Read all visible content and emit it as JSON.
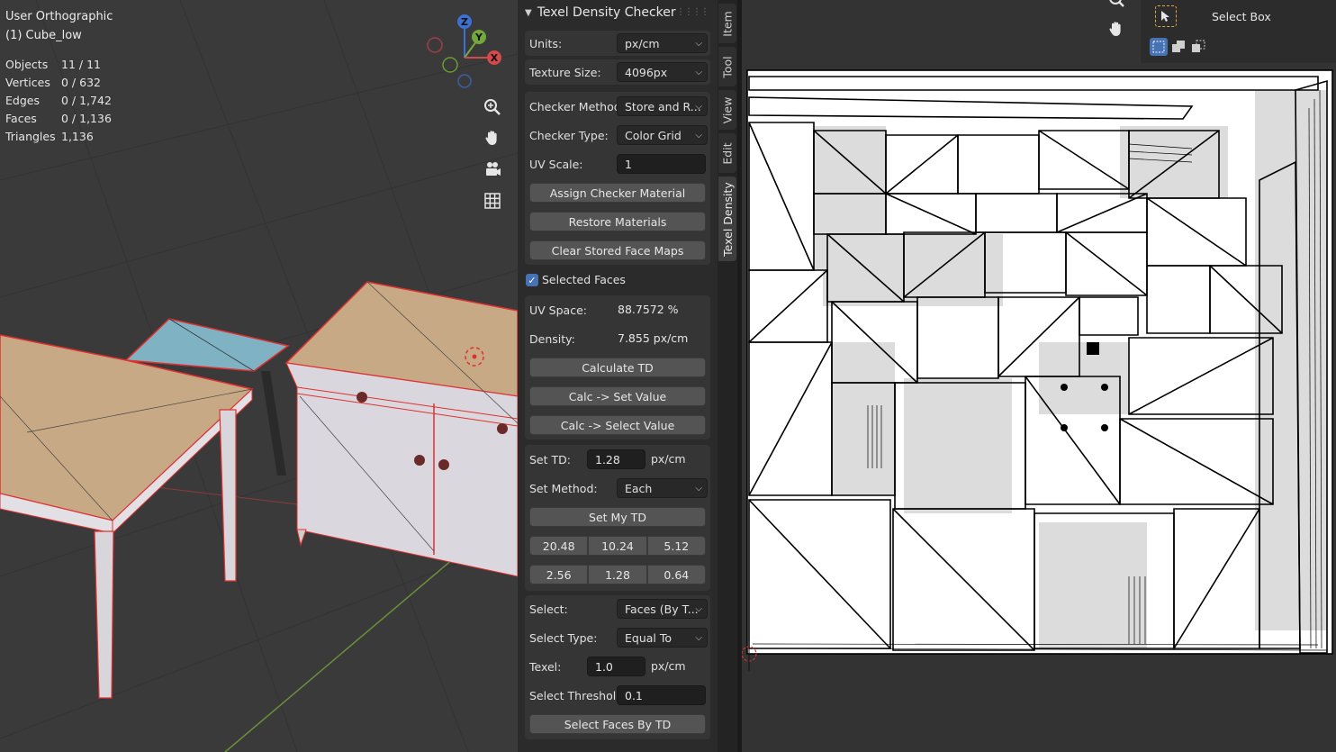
{
  "viewport": {
    "view_name": "User Orthographic",
    "object_name": "(1) Cube_low",
    "stats": [
      {
        "label": "Objects",
        "value": "11 / 11"
      },
      {
        "label": "Vertices",
        "value": "0 / 632"
      },
      {
        "label": "Edges",
        "value": "0 / 1,742"
      },
      {
        "label": "Faces",
        "value": "0 / 1,136"
      },
      {
        "label": "Triangles",
        "value": "1,136"
      }
    ],
    "gizmo_axes": [
      "Z",
      "Y",
      "X"
    ],
    "nav_icons": [
      "zoom-icon",
      "hand-icon",
      "camera-icon",
      "grid-icon"
    ]
  },
  "panel": {
    "title": "Texel Density Checker",
    "units_label": "Units:",
    "units_value": "px/cm",
    "texture_size_label": "Texture Size:",
    "texture_size_value": "4096px",
    "checker_method_label": "Checker Method:",
    "checker_method_value": "Store and R...",
    "checker_type_label": "Checker Type:",
    "checker_type_value": "Color Grid",
    "uv_scale_label": "UV Scale:",
    "uv_scale_value": "1",
    "assign_checker": "Assign Checker Material",
    "restore_materials": "Restore Materials",
    "clear_face_maps": "Clear Stored Face Maps",
    "selected_faces_label": "Selected Faces",
    "selected_faces_checked": true,
    "uv_space_label": "UV Space:",
    "uv_space_value": "88.7572 %",
    "density_label": "Density:",
    "density_value": "7.855 px/cm",
    "calculate_td": "Calculate TD",
    "calc_set_value": "Calc -> Set Value",
    "calc_select_value": "Calc -> Select Value",
    "set_td_label": "Set TD:",
    "set_td_value": "1.28",
    "set_td_unit": "px/cm",
    "set_method_label": "Set Method:",
    "set_method_value": "Each",
    "set_my_td": "Set My TD",
    "presets_row1": [
      "20.48",
      "10.24",
      "5.12"
    ],
    "presets_row2": [
      "2.56",
      "1.28",
      "0.64"
    ],
    "select_label": "Select:",
    "select_value": "Faces (By T...",
    "select_type_label": "Select Type:",
    "select_type_value": "Equal To",
    "texel_label": "Texel:",
    "texel_value": "1.0",
    "texel_unit": "px/cm",
    "select_threshold_label": "Select Threshold:",
    "select_threshold_value": "0.1",
    "select_faces_by_td": "Select Faces By TD"
  },
  "tabs": [
    "Item",
    "Tool",
    "View",
    "Edit",
    "Texel Density"
  ],
  "active_tab": "Texel Density",
  "uv_editor": {
    "tool_label": "Select Box"
  },
  "colors": {
    "accent": "#4772b3",
    "selection_outline": "#e03030",
    "panel_bg": "#2b2b2b",
    "viewport_bg": "#3a3a3a"
  }
}
